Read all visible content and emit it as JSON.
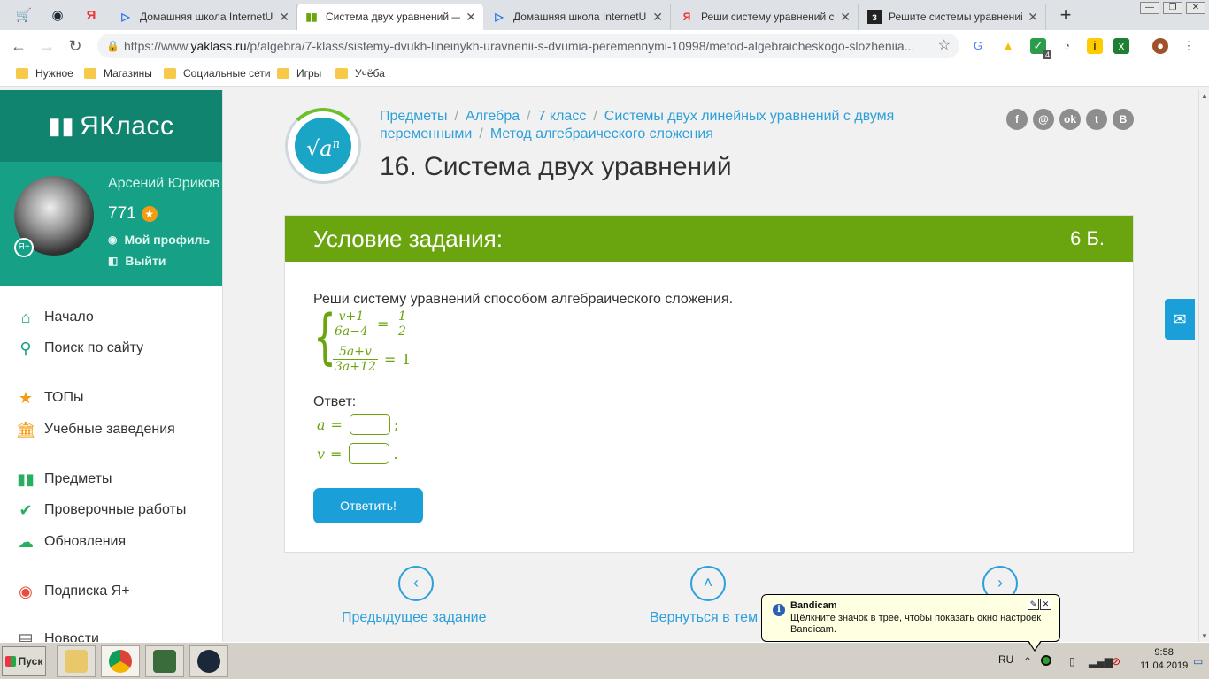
{
  "browser": {
    "tabs": [
      {
        "title": "Домашняя школа InternetUrок",
        "favicon": "play-icon"
      },
      {
        "title": "Система двух уравнений — з",
        "favicon": "yaklass-icon",
        "active": true
      },
      {
        "title": "Домашняя школа InternetUrок",
        "favicon": "play-icon"
      },
      {
        "title": "Реши систему уравнений спо",
        "favicon": "yandex-icon"
      },
      {
        "title": "Решите системы уравнений с",
        "favicon": "znanija-icon"
      }
    ],
    "url_prefix": "https://www.",
    "url_domain": "yaklass.ru",
    "url_path": "/p/algebra/7-klass/sistemy-dvukh-lineinykh-uravnenii-s-dvumia-peremennymi-10998/metod-algebraicheskogo-slozheniia...",
    "extension_badge": "4",
    "bookmarks": [
      "Нужное",
      "Магазины",
      "Социальные сети",
      "Игры",
      "Учёба"
    ]
  },
  "sidebar": {
    "logo": "ЯКласс",
    "user_name": "Арсений Юриков",
    "points": "771",
    "badge": "Я+",
    "profile_link": "Мой профиль",
    "logout_link": "Выйти",
    "menu": [
      {
        "label": "Начало",
        "icon": "home-icon"
      },
      {
        "label": "Поиск по сайту",
        "icon": "search-icon"
      },
      {
        "label": "ТОПы",
        "icon": "star-icon"
      },
      {
        "label": "Учебные заведения",
        "icon": "institution-icon"
      },
      {
        "label": "Предметы",
        "icon": "books-icon"
      },
      {
        "label": "Проверочные работы",
        "icon": "check-circle-icon"
      },
      {
        "label": "Обновления",
        "icon": "cloud-upload-icon"
      },
      {
        "label": "Подписка Я+",
        "icon": "yaplus-icon"
      },
      {
        "label": "Новости",
        "icon": "news-icon"
      }
    ]
  },
  "main": {
    "breadcrumbs": [
      "Предметы",
      "Алгебра",
      "7 класс",
      "Системы двух линейных уравнений с двумя переменными",
      "Метод алгебраического сложения"
    ],
    "title": "16. Система двух уравнений",
    "social": [
      "f",
      "@",
      "ok",
      "t",
      "В"
    ],
    "card_title": "Условие задания:",
    "card_score": "6 Б.",
    "task_text": "Реши систему уравнений способом алгебраического сложения.",
    "eq1": {
      "num": "v+1",
      "den": "6a−4",
      "rhs_num": "1",
      "rhs_den": "2"
    },
    "eq2": {
      "num": "5a+v",
      "den": "3a+12",
      "rhs": "1"
    },
    "answer_label": "Ответ:",
    "var_a": "a",
    "var_v": "v",
    "equals": "=",
    "sep_a": ";",
    "sep_v": ".",
    "submit_label": "Ответить!",
    "prev_label": "Предыдущее задание",
    "back_label": "Вернуться в тем"
  },
  "taskbar": {
    "start_label": "Пуск",
    "lang": "RU",
    "time": "9:58",
    "date": "11.04.2019"
  },
  "balloon": {
    "title": "Bandicam",
    "message": "Щёлкните значок в трее, чтобы показать окно настроек Bandicam."
  },
  "colors": {
    "sidebar_dark": "#11846f",
    "sidebar_user": "#16a085",
    "card_header": "#6aa50f",
    "link": "#2d9fd9",
    "button": "#1a9fd8"
  }
}
